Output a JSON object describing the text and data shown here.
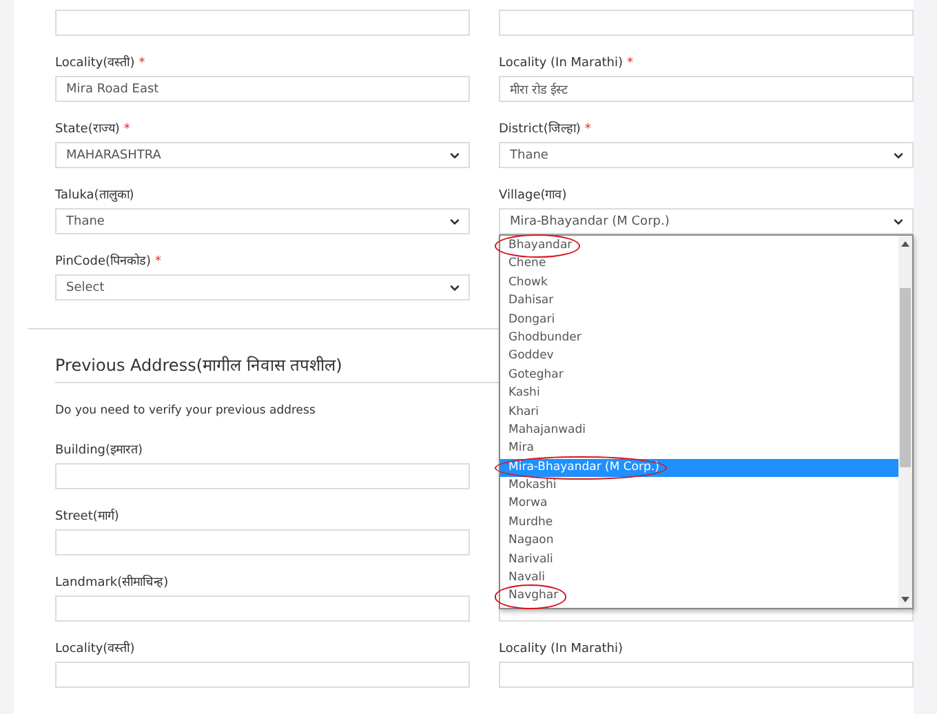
{
  "current_address": {
    "fields": [
      {
        "kind": "input"
      },
      {
        "kind": "input"
      },
      {
        "kind": "input",
        "label": "Locality(वस्ती)",
        "required_mark": "*",
        "value": "Mira Road East"
      },
      {
        "kind": "input",
        "label": "Locality (In Marathi)",
        "required_mark": "*",
        "value": "मीरा रोड ईस्ट"
      },
      {
        "kind": "select",
        "label": "State(राज्य)",
        "required_mark": "*",
        "value": "MAHARASHTRA"
      },
      {
        "kind": "select",
        "label": "District(जिल्हा)",
        "required_mark": "*",
        "value": "Thane"
      },
      {
        "kind": "select",
        "label": "Taluka(तालुका)",
        "value": "Thane"
      },
      {
        "kind": "select",
        "label": "Village(गाव)",
        "value": "Mira-Bhayandar (M Corp.)",
        "expanded": true,
        "options": [
          {
            "label": "Bhayandar",
            "selected": false,
            "circled": true
          },
          {
            "label": "Chene",
            "selected": false,
            "circled": false
          },
          {
            "label": "Chowk",
            "selected": false,
            "circled": false
          },
          {
            "label": "Dahisar",
            "selected": false,
            "circled": false
          },
          {
            "label": "Dongari",
            "selected": false,
            "circled": false
          },
          {
            "label": "Ghodbunder",
            "selected": false,
            "circled": false
          },
          {
            "label": "Goddev",
            "selected": false,
            "circled": false
          },
          {
            "label": "Goteghar",
            "selected": false,
            "circled": false
          },
          {
            "label": "Kashi",
            "selected": false,
            "circled": false
          },
          {
            "label": "Khari",
            "selected": false,
            "circled": false
          },
          {
            "label": "Mahajanwadi",
            "selected": false,
            "circled": false
          },
          {
            "label": "Mira",
            "selected": false,
            "circled": false
          },
          {
            "label": "Mira-Bhayandar (M Corp.)",
            "selected": true,
            "circled": true
          },
          {
            "label": "Mokashi",
            "selected": false,
            "circled": false
          },
          {
            "label": "Morwa",
            "selected": false,
            "circled": false
          },
          {
            "label": "Murdhe",
            "selected": false,
            "circled": false
          },
          {
            "label": "Nagaon",
            "selected": false,
            "circled": false
          },
          {
            "label": "Narivali",
            "selected": false,
            "circled": false
          },
          {
            "label": "Navali",
            "selected": false,
            "circled": false
          },
          {
            "label": "Navghar",
            "selected": false,
            "circled": true
          }
        ]
      },
      {
        "kind": "select",
        "label": "PinCode(पिनकोड)",
        "required_mark": "*",
        "value": "Select"
      }
    ]
  },
  "previous_address": {
    "title": "Previous Address(मागील निवास तपशील)",
    "question": "Do you need to verify your previous address",
    "fields": [
      {
        "kind": "input",
        "label": "Building(इमारत)"
      },
      {
        "kind": "empty"
      },
      {
        "kind": "input",
        "label": "Street(मार्ग)"
      },
      {
        "kind": "empty"
      },
      {
        "kind": "input",
        "label": "Landmark(सीमाचिन्ह)"
      },
      {
        "kind": "input"
      },
      {
        "kind": "input",
        "label": "Locality(वस्ती)"
      },
      {
        "kind": "input",
        "label": "Locality (In Marathi)"
      }
    ]
  }
}
